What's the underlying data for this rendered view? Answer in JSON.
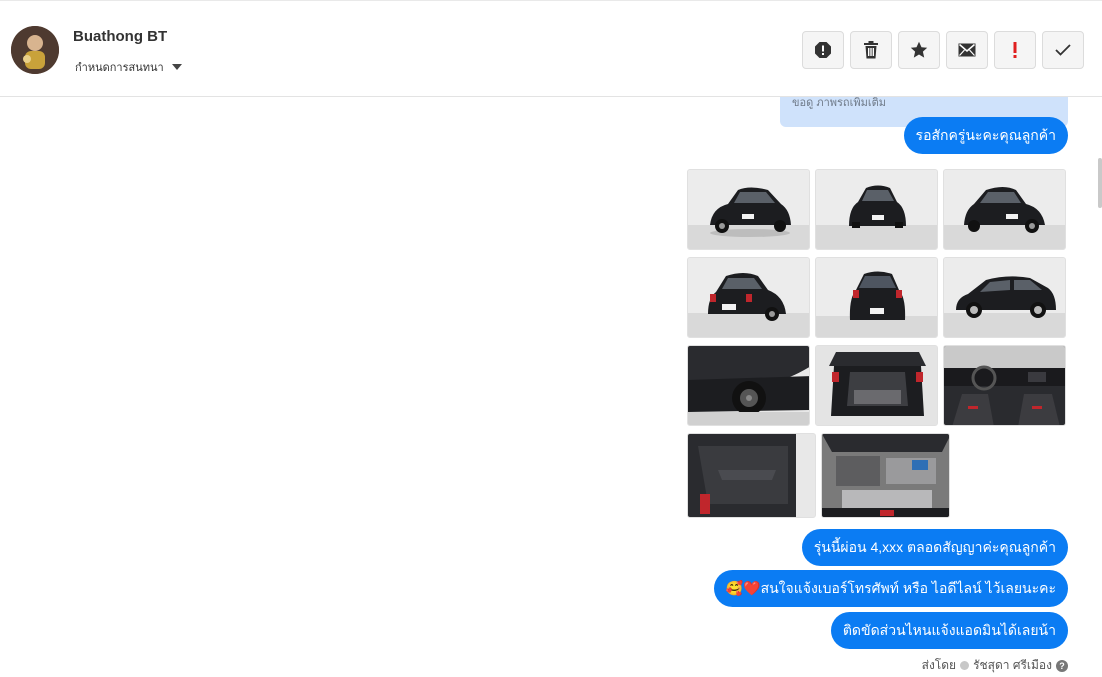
{
  "header": {
    "contact_name": "Buathong BT",
    "conversation_label": "กำหนดการสนทนา",
    "actions": [
      {
        "name": "spam-icon",
        "color": "#333333"
      },
      {
        "name": "trash-icon",
        "color": "#333333"
      },
      {
        "name": "star-icon",
        "color": "#333333"
      },
      {
        "name": "mail-icon",
        "color": "#333333"
      },
      {
        "name": "exclamation-icon",
        "color": "#e02020"
      },
      {
        "name": "check-icon",
        "color": "#333333"
      }
    ]
  },
  "chat": {
    "note_text": "ขอดู ภาพรถเพิ่มเติม",
    "bubble_wait": "รอสักครู่นะคะคุณลูกค้า",
    "bubble_installment": "รุ่นนี้ผ่อน 4,xxx ตลอดสัญญาค่ะคุณลูกค้า",
    "bubble_contact": "🥰❤️สนใจแจ้งเบอร์โทรศัพท์ หรือ ไอดีไลน์  ไว้เลยนะคะ",
    "bubble_admin": "ติดขัดส่วนไหนแจ้งแอดมินได้เลยน้า",
    "sent_by_label": "ส่งโดย",
    "sender_name": "รัชสุดา ศรีเมือง",
    "help_symbol": "?"
  },
  "photos": [
    {
      "name": "car-front-left-photo"
    },
    {
      "name": "car-front-photo"
    },
    {
      "name": "car-front-right-photo"
    },
    {
      "name": "car-rear-left-photo"
    },
    {
      "name": "car-rear-photo"
    },
    {
      "name": "car-side-photo"
    },
    {
      "name": "car-wheel-photo"
    },
    {
      "name": "car-trunk-photo"
    },
    {
      "name": "car-interior-photo"
    },
    {
      "name": "car-door-panel-photo"
    },
    {
      "name": "car-engine-photo"
    }
  ],
  "colors": {
    "bubble": "#0b7cf3",
    "note": "#cfe2fb",
    "car_body": "#1c1d20",
    "background": "#ffffff"
  }
}
